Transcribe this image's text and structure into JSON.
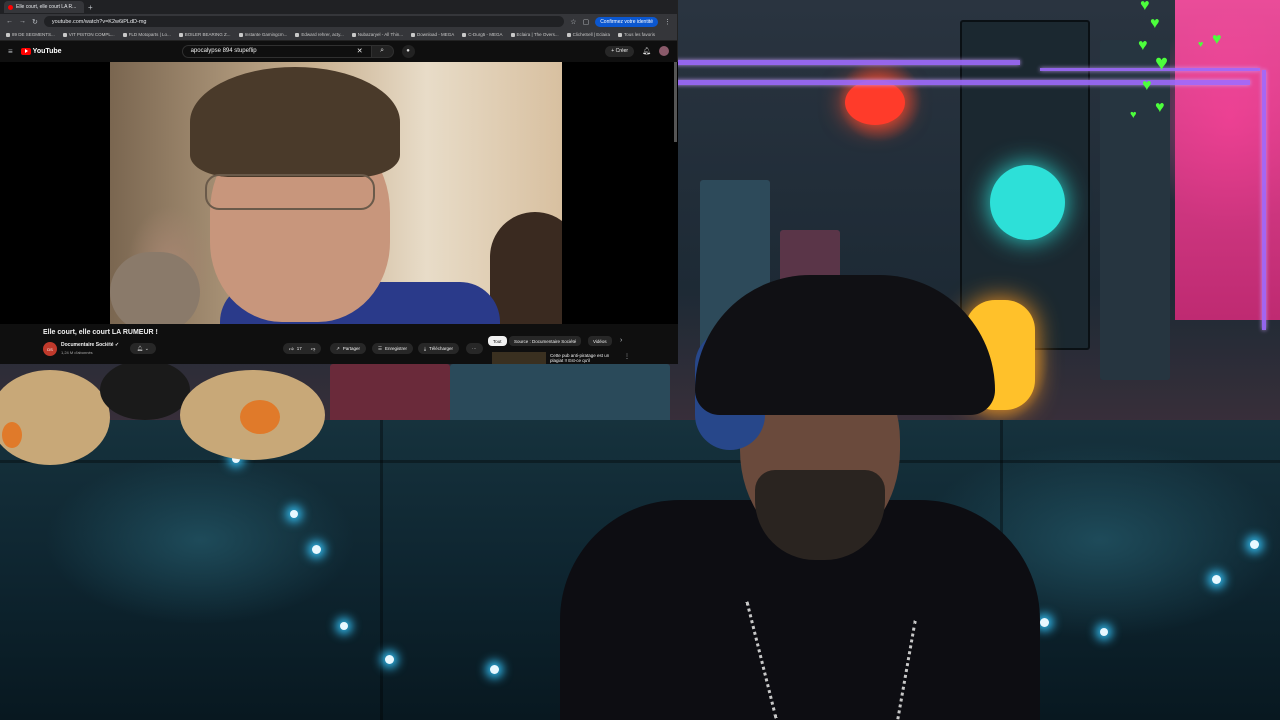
{
  "browser": {
    "tab_title": "Elle court, elle court LA R...",
    "url": "youtube.com/watch?v=K2w6iPLdD-mg",
    "identity_button": "Confirmez votre identité",
    "bookmarks": [
      "89 DE SEGMENTS...",
      "VIT PISTON COMPL...",
      "FLD Motoparts | Lo...",
      "BOILER BEARING Z...",
      "Instante Gamingcm...",
      "Edward rehrer, acty...",
      "Nubazaryel - All Thin...",
      "Download - MEGA",
      "C-Durg5 - MEGA",
      "Eclaira | The Overs...",
      "ClicheSell | Eclaira",
      "Tous les favoris"
    ]
  },
  "youtube": {
    "logo_text": "YouTube",
    "search_query": "apocalypse 894 stupeflip",
    "create_label": "Créer",
    "video_title": "Elle court, elle court LA RUMEUR !",
    "channel_name": "Documentaire Société",
    "channel_avatar_text": "DS",
    "subscribers": "1,24 M d'abonnés",
    "likes": "17",
    "share_label": "Partager",
    "save_label": "Enregistrer",
    "download_label": "Télécharger",
    "more_label": "···",
    "chips": [
      "Tout",
      "Source : Documentaire Société",
      "Vidéos"
    ],
    "rec_title": "Cette pub anti-piratage est un plagiat !! Est-ce qu'il"
  },
  "colors": {
    "youtube_red": "#ff0000",
    "overlay_purple": "#a06cff",
    "hearts_green": "#4cff3c",
    "neon_pink": "#ff4fa3",
    "neon_cyan": "#28e6dc"
  }
}
